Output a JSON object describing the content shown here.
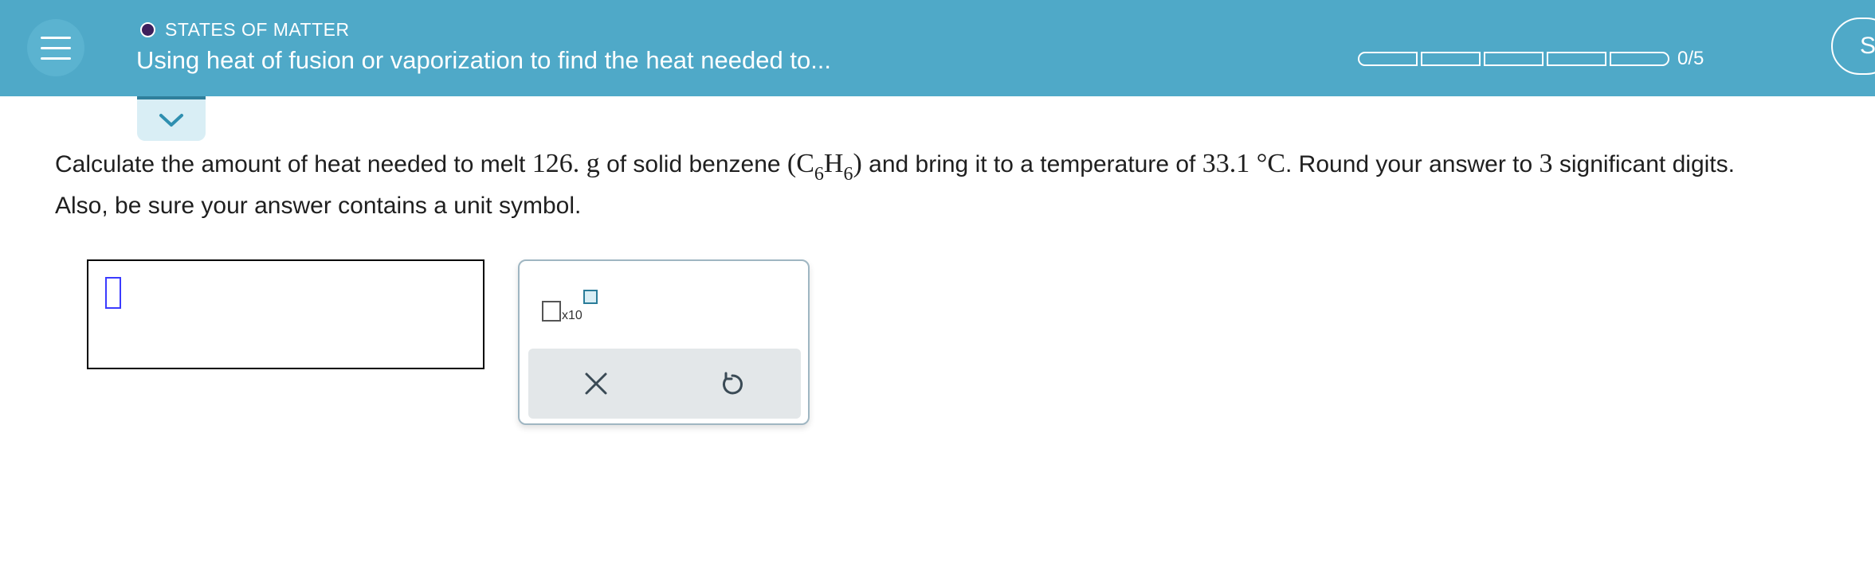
{
  "header": {
    "topic": "STATES OF MATTER",
    "title": "Using heat of fusion or vaporization to find the heat needed to...",
    "progress": {
      "completed": 0,
      "total": 5,
      "label": "0/5"
    },
    "avatar_initial": "S"
  },
  "question": {
    "t1": "Calculate the amount of heat needed to melt ",
    "mass": "126.",
    "unit_g": " g",
    "t2": " of solid benzene ",
    "formula_open": "(C",
    "sub1": "6",
    "formula_h": "H",
    "sub2": "6",
    "formula_close": ")",
    "t3": " and bring it to a temperature of ",
    "temp": "33.1 °C",
    "t4": ". Round your answer to ",
    "digits": "3",
    "t5": " significant digits.",
    "line2": "Also, be sure your answer contains a unit symbol."
  },
  "answer": {
    "value": ""
  },
  "toolbar": {
    "x10_label": "x10",
    "icons": [
      "scientific-notation-icon",
      "close-icon",
      "undo-icon"
    ]
  },
  "colors": {
    "header_bg": "#4fa9c8",
    "topic_dot": "#3d1f5c",
    "caret": "#3b3bff",
    "tool_panel_bg": "#e3e7e9"
  }
}
